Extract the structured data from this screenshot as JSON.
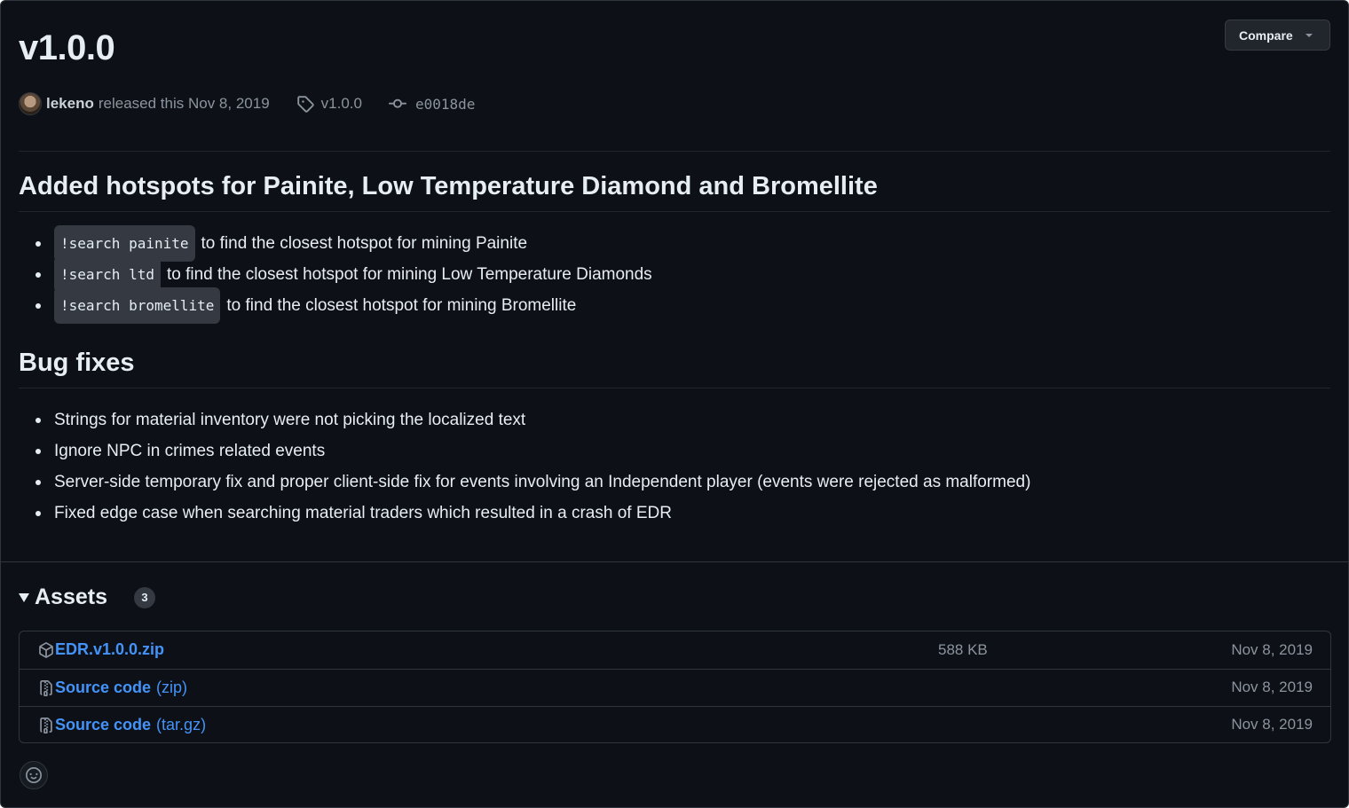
{
  "release": {
    "title": "v1.0.0",
    "compare_label": "Compare",
    "author": "lekeno",
    "released_text": "released this Nov 8, 2019",
    "tag": "v1.0.0",
    "commit": "e0018de"
  },
  "sections": [
    {
      "heading": "Added hotspots for Painite, Low Temperature Diamond and Bromellite",
      "items": [
        {
          "code": "!search painite",
          "text": "to find the closest hotspot for mining Painite"
        },
        {
          "code": "!search ltd",
          "text": "to find the closest hotspot for mining Low Temperature Diamonds"
        },
        {
          "code": "!search bromellite",
          "text": "to find the closest hotspot for mining Bromellite"
        }
      ]
    },
    {
      "heading": "Bug fixes",
      "items": [
        {
          "text": "Strings for material inventory were not picking the localized text"
        },
        {
          "text": "Ignore NPC in crimes related events"
        },
        {
          "text": "Server-side temporary fix and proper client-side fix for events involving an Independent player (events were rejected as malformed)"
        },
        {
          "text": "Fixed edge case when searching material traders which resulted in a crash of EDR"
        }
      ]
    }
  ],
  "assets": {
    "title": "Assets",
    "count": "3",
    "rows": [
      {
        "icon": "package-icon",
        "name": "EDR.v1.0.0.zip",
        "suffix": "",
        "size": "588 KB",
        "date": "Nov 8, 2019"
      },
      {
        "icon": "file-zip-icon",
        "name": "Source code",
        "suffix": "(zip)",
        "size": "",
        "date": "Nov 8, 2019"
      },
      {
        "icon": "file-zip-icon",
        "name": "Source code",
        "suffix": "(tar.gz)",
        "size": "",
        "date": "Nov 8, 2019"
      }
    ]
  },
  "colors": {
    "background": "#0d1117",
    "link": "#4493f8",
    "muted": "#8b949e",
    "border": "#30363d"
  }
}
